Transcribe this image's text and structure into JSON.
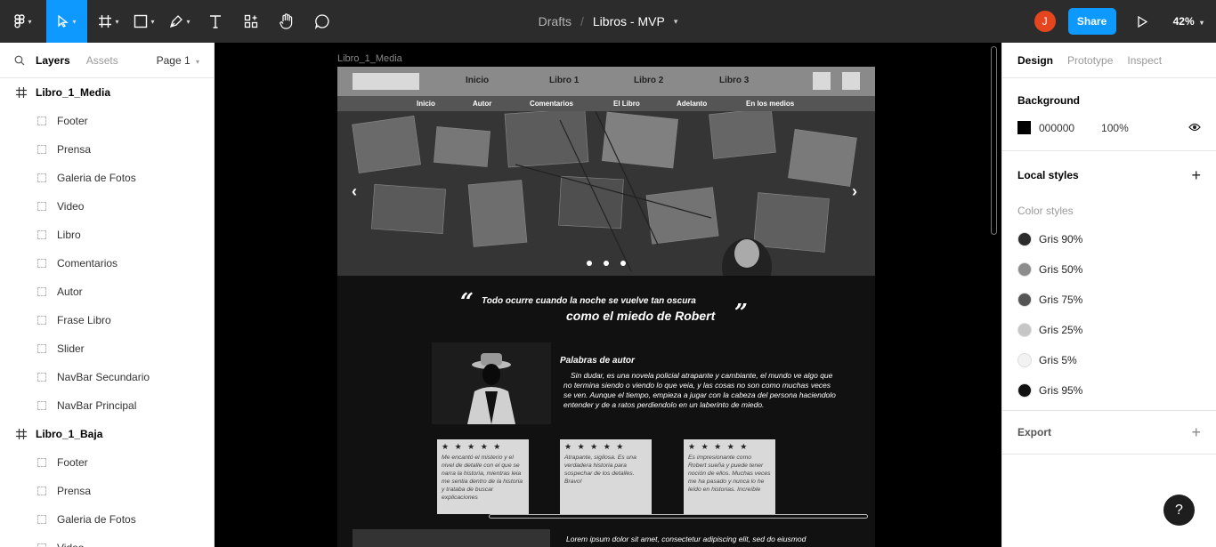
{
  "toolbar": {
    "breadcrumb_drafts": "Drafts",
    "breadcrumb_sep": "/",
    "file_name": "Libros - MVP",
    "avatar_initial": "J",
    "share_label": "Share",
    "zoom": "42%",
    "accent": "#0d99ff"
  },
  "left_panel": {
    "tab_layers": "Layers",
    "tab_assets": "Assets",
    "page_selector": "Page 1",
    "frames": [
      {
        "name": "Libro_1_Media",
        "children": [
          "Footer",
          "Prensa",
          "Galeria de Fotos",
          "Video",
          "Libro",
          "Comentarios",
          "Autor",
          "Frase Libro",
          "Slider",
          "NavBar Secundario",
          "NavBar Principal"
        ]
      },
      {
        "name": "Libro_1_Baja",
        "children": [
          "Footer",
          "Prensa",
          "Galeria de Fotos",
          "Video"
        ]
      }
    ]
  },
  "canvas": {
    "frame_label": "Libro_1_Media",
    "nav_primary": [
      "Inicio",
      "Libro 1",
      "Libro 2",
      "Libro 3"
    ],
    "nav_secondary": [
      "Inicio",
      "Autor",
      "Comentarios",
      "El Libro",
      "Adelanto",
      "En los medios"
    ],
    "quote_line1": "Todo ocurre cuando la noche se  vuelve tan oscura",
    "quote_line2": "como el miedo de Robert",
    "author_title": "Palabras de autor",
    "author_text": "Sin dudar, es una novela policial atrapante y cambiante, el mundo ve algo que no termina siendo o viendo lo que veia, y las cosas no son como muchas veces se ven. Aunque el tiempo, empieza a jugar con la cabeza del persona haciendolo entender y de a ratos perdiendolo en un laberinto de miedo.",
    "reviews": [
      {
        "stars": "★ ★ ★ ★ ★",
        "text": "Me encantó el misterio y el nivel de detalle con el que se narra la historia, mientras leia me sentia dentro de la historia y trataba de buscar explicaciones"
      },
      {
        "stars": "★ ★ ★ ★ ★",
        "text": "Atrapante, sigilosa. Es una verdadera historia para sospechar de los detalles. Bravo!"
      },
      {
        "stars": "★ ★ ★ ★ ★",
        "text": "Es impresionante como Robert sueña y puede tener noción de ellos. Muchas veces me ha pasado y nunca lo he leído en historias. Increíble"
      }
    ],
    "lorem": "Lorem ipsum dolor sit amet, consectetur adipiscing elit, sed do eiusmod"
  },
  "right_panel": {
    "tab_design": "Design",
    "tab_prototype": "Prototype",
    "tab_inspect": "Inspect",
    "background_title": "Background",
    "background_hex": "000000",
    "background_opacity": "100%",
    "local_styles_title": "Local styles",
    "color_styles_label": "Color styles",
    "color_styles": [
      {
        "name": "Gris 90%",
        "color": "#2b2b2b"
      },
      {
        "name": "Gris 50%",
        "color": "#8c8c8c"
      },
      {
        "name": "Gris 75%",
        "color": "#555555"
      },
      {
        "name": "Gris 25%",
        "color": "#c6c6c6"
      },
      {
        "name": "Gris 5%",
        "color": "#f2f2f2"
      },
      {
        "name": "Gris 95%",
        "color": "#111111"
      }
    ],
    "export_title": "Export",
    "help_label": "?"
  }
}
